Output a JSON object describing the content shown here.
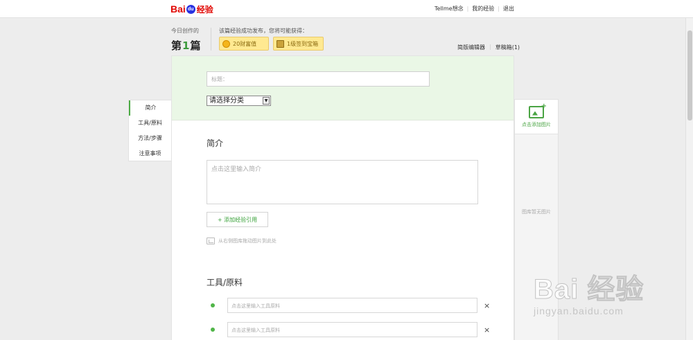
{
  "header": {
    "logo": {
      "bai": "Bai",
      "du": "du",
      "jingyan": "经验"
    },
    "links": [
      "Tellme想念",
      "我的经验",
      "退出"
    ]
  },
  "stats": {
    "today_label": "今日创作的",
    "count_prefix": "第",
    "count_value": "1",
    "count_suffix": "篇",
    "reward_text": "该篇经验成功发布，您将可能获得：",
    "badge_wealth": "20财富值",
    "badge_sign": "1级签到宝箱",
    "editor_simple": "简版编辑器",
    "drafts": "草稿箱(1)"
  },
  "form": {
    "title_placeholder": "标题：",
    "category_selected": "请选择分类"
  },
  "nav": {
    "items": [
      "简介",
      "工具/原料",
      "方法/步骤",
      "注意事项"
    ]
  },
  "intro": {
    "title": "简介",
    "placeholder": "点击这里输入简介",
    "add_ref": "+ 添加经验引用",
    "drag_hint": "从右侧图库拖动图片到此处"
  },
  "tools": {
    "title": "工具/原料",
    "rows": [
      {
        "placeholder": "点击这里输入工具原料",
        "close": "×"
      },
      {
        "placeholder": "点击这里输入工具原料",
        "close": "×"
      }
    ]
  },
  "gallery": {
    "add_image": "点击添加图片",
    "empty": "图库暂无图片"
  },
  "watermark": {
    "line1": "Bai 经验",
    "line2": "jingyan.baidu.com"
  },
  "colors": {
    "accent_green": "#4aa443",
    "brand_red": "#e10602",
    "brand_blue": "#2932e1"
  },
  "icons": [
    "baidu-paw-icon",
    "coin-icon",
    "treasure-box-icon",
    "image-icon",
    "add-image-icon",
    "close-icon",
    "chevron-down-icon"
  ]
}
